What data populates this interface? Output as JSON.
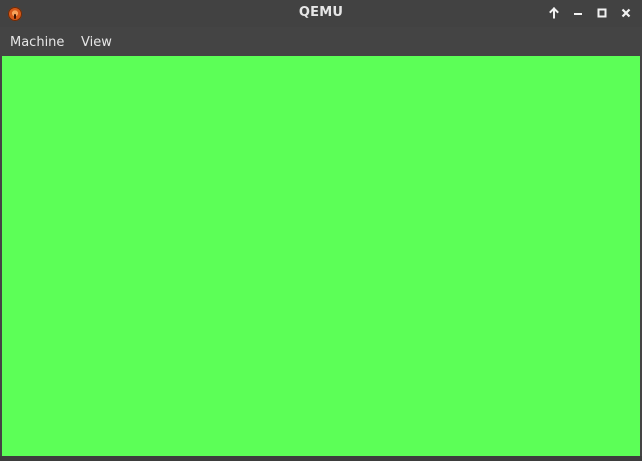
{
  "window": {
    "title": "QEMU",
    "app_icon": "qemu-icon",
    "controls": [
      {
        "name": "keep-above",
        "icon": "arrow-up-icon"
      },
      {
        "name": "minimize",
        "icon": "minimize-icon"
      },
      {
        "name": "maximize",
        "icon": "maximize-icon"
      },
      {
        "name": "close",
        "icon": "close-icon"
      }
    ]
  },
  "menu": {
    "items": [
      {
        "label": "Machine"
      },
      {
        "label": "View"
      }
    ]
  },
  "display": {
    "background": "#5cff57"
  },
  "colors": {
    "titlebar": "#424242",
    "menubar": "#444444",
    "text": "#e6e6e6"
  }
}
